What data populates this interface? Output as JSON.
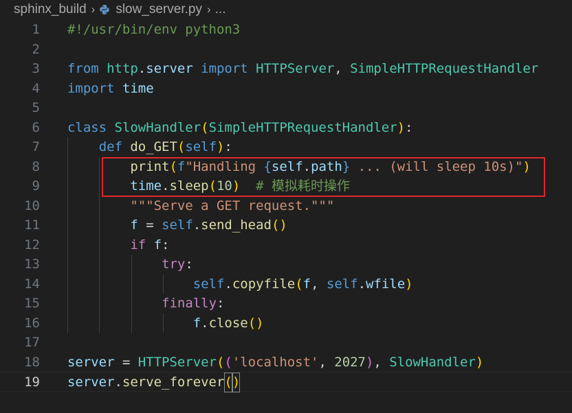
{
  "breadcrumb": {
    "folder": "sphinx_build",
    "file": "slow_server.py",
    "more": "..."
  },
  "colors": {
    "background": "#1f1f1f",
    "highlight_box": "#e0262e",
    "keyword": "#569cd6",
    "class": "#4ec9b0",
    "function": "#dcdcaa",
    "string": "#ce9178",
    "comment": "#6a9955"
  },
  "icons": {
    "file_type": "python-icon",
    "separator": "chevron-right-icon"
  },
  "editor": {
    "active_line": 19,
    "highlighted_lines": [
      8,
      9
    ],
    "lines": [
      {
        "n": "1",
        "text": "#!/usr/bin/env python3"
      },
      {
        "n": "2",
        "text": ""
      },
      {
        "n": "3",
        "text": "from http.server import HTTPServer, SimpleHTTPRequestHandler"
      },
      {
        "n": "4",
        "text": "import time"
      },
      {
        "n": "5",
        "text": ""
      },
      {
        "n": "6",
        "text": "class SlowHandler(SimpleHTTPRequestHandler):"
      },
      {
        "n": "7",
        "text": "    def do_GET(self):"
      },
      {
        "n": "8",
        "text": "        print(f\"Handling {self.path} ... (will sleep 10s)\")"
      },
      {
        "n": "9",
        "text": "        time.sleep(10)  # 模拟耗时操作"
      },
      {
        "n": "10",
        "text": "        \"\"\"Serve a GET request.\"\"\""
      },
      {
        "n": "11",
        "text": "        f = self.send_head()"
      },
      {
        "n": "12",
        "text": "        if f:"
      },
      {
        "n": "13",
        "text": "            try:"
      },
      {
        "n": "14",
        "text": "                self.copyfile(f, self.wfile)"
      },
      {
        "n": "15",
        "text": "            finally:"
      },
      {
        "n": "16",
        "text": "                f.close()"
      },
      {
        "n": "17",
        "text": ""
      },
      {
        "n": "18",
        "text": "server = HTTPServer(('localhost', 2027), SlowHandler)"
      },
      {
        "n": "19",
        "text": "server.serve_forever()"
      }
    ]
  }
}
